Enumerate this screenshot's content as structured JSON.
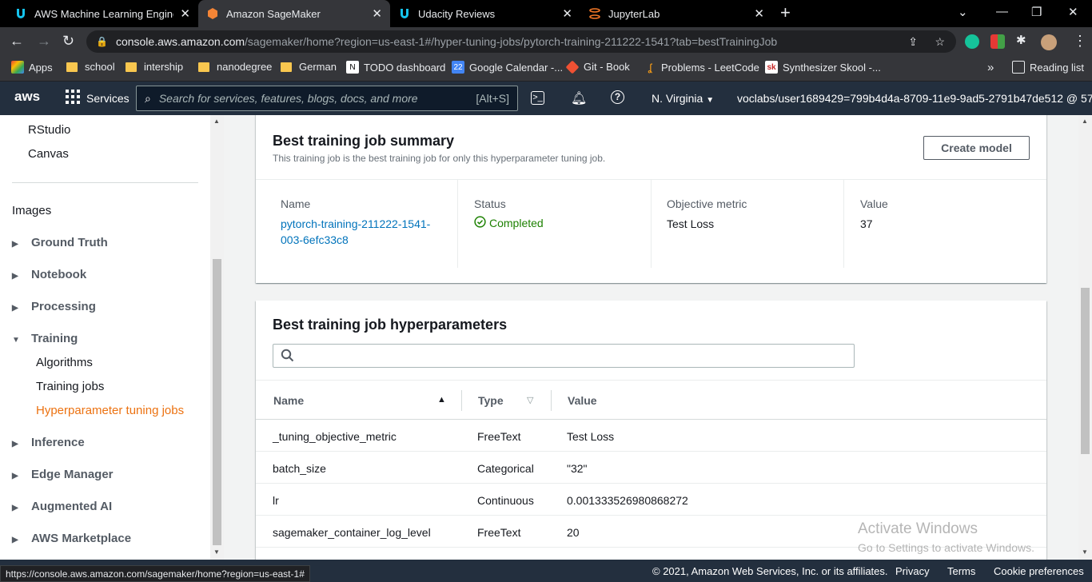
{
  "browser": {
    "tabs": [
      {
        "title": "AWS Machine Learning Engineer",
        "icon": "udacity-icon"
      },
      {
        "title": "Amazon SageMaker",
        "icon": "aws-icon"
      },
      {
        "title": "Udacity Reviews",
        "icon": "udacity-icon"
      },
      {
        "title": "JupyterLab",
        "icon": "jupyter-icon"
      }
    ],
    "url_host": "console.aws.amazon.com",
    "url_path": "/sagemaker/home?region=us-east-1#/hyper-tuning-jobs/pytorch-training-211222-1541?tab=bestTrainingJob",
    "bookmarks": [
      {
        "label": "Apps"
      },
      {
        "label": "school"
      },
      {
        "label": "intership"
      },
      {
        "label": "nanodegree"
      },
      {
        "label": "German"
      },
      {
        "label": "TODO dashboard"
      },
      {
        "label": "Google Calendar -..."
      },
      {
        "label": "Git - Book"
      },
      {
        "label": "Problems - LeetCode"
      },
      {
        "label": "Synthesizer Skool -..."
      }
    ],
    "reading_list": "Reading list",
    "status_url": "https://console.aws.amazon.com/sagemaker/home?region=us-east-1#"
  },
  "aws": {
    "logo": "aws",
    "services": "Services",
    "search_placeholder": "Search for services, features, blogs, docs, and more",
    "search_shortcut": "[Alt+S]",
    "region": "N. Virginia",
    "account": "voclabs/user1689429=799b4d4a-8709-11e9-9ad5-2791b47de512 @ 57..."
  },
  "sidebar": {
    "top_items": [
      "RStudio",
      "Canvas"
    ],
    "images": "Images",
    "groups": [
      {
        "label": "Ground Truth"
      },
      {
        "label": "Notebook"
      },
      {
        "label": "Processing"
      },
      {
        "label": "Training"
      }
    ],
    "training_children": [
      "Algorithms",
      "Training jobs",
      "Hyperparameter tuning jobs"
    ],
    "groups_after": [
      {
        "label": "Inference"
      },
      {
        "label": "Edge Manager"
      },
      {
        "label": "Augmented AI"
      },
      {
        "label": "AWS Marketplace"
      }
    ]
  },
  "summary": {
    "title": "Best training job summary",
    "description": "This training job is the best training job for only this hyperparameter tuning job.",
    "create_model": "Create model",
    "name_label": "Name",
    "name_value": "pytorch-training-211222-1541-003-6efc33c8",
    "status_label": "Status",
    "status_value": "Completed",
    "metric_label": "Objective metric",
    "metric_value": "Test Loss",
    "value_label": "Value",
    "value_value": "37"
  },
  "hyperparameters": {
    "title": "Best training job hyperparameters",
    "columns": [
      "Name",
      "Type",
      "Value"
    ],
    "rows": [
      {
        "name": "_tuning_objective_metric",
        "type": "FreeText",
        "value": "Test Loss"
      },
      {
        "name": "batch_size",
        "type": "Categorical",
        "value": "\"32\""
      },
      {
        "name": "lr",
        "type": "Continuous",
        "value": "0.001333526980868272"
      },
      {
        "name": "sagemaker_container_log_level",
        "type": "FreeText",
        "value": "20"
      }
    ]
  },
  "footer": {
    "copyright": "© 2021, Amazon Web Services, Inc. or its affiliates.",
    "links": [
      "Privacy",
      "Terms",
      "Cookie preferences"
    ]
  },
  "watermark": {
    "line1": "Activate Windows",
    "line2": "Go to Settings to activate Windows."
  },
  "colors": {
    "aws_nav": "#232f3e",
    "link": "#0073bb",
    "active": "#ec7211",
    "success": "#1d8102"
  }
}
